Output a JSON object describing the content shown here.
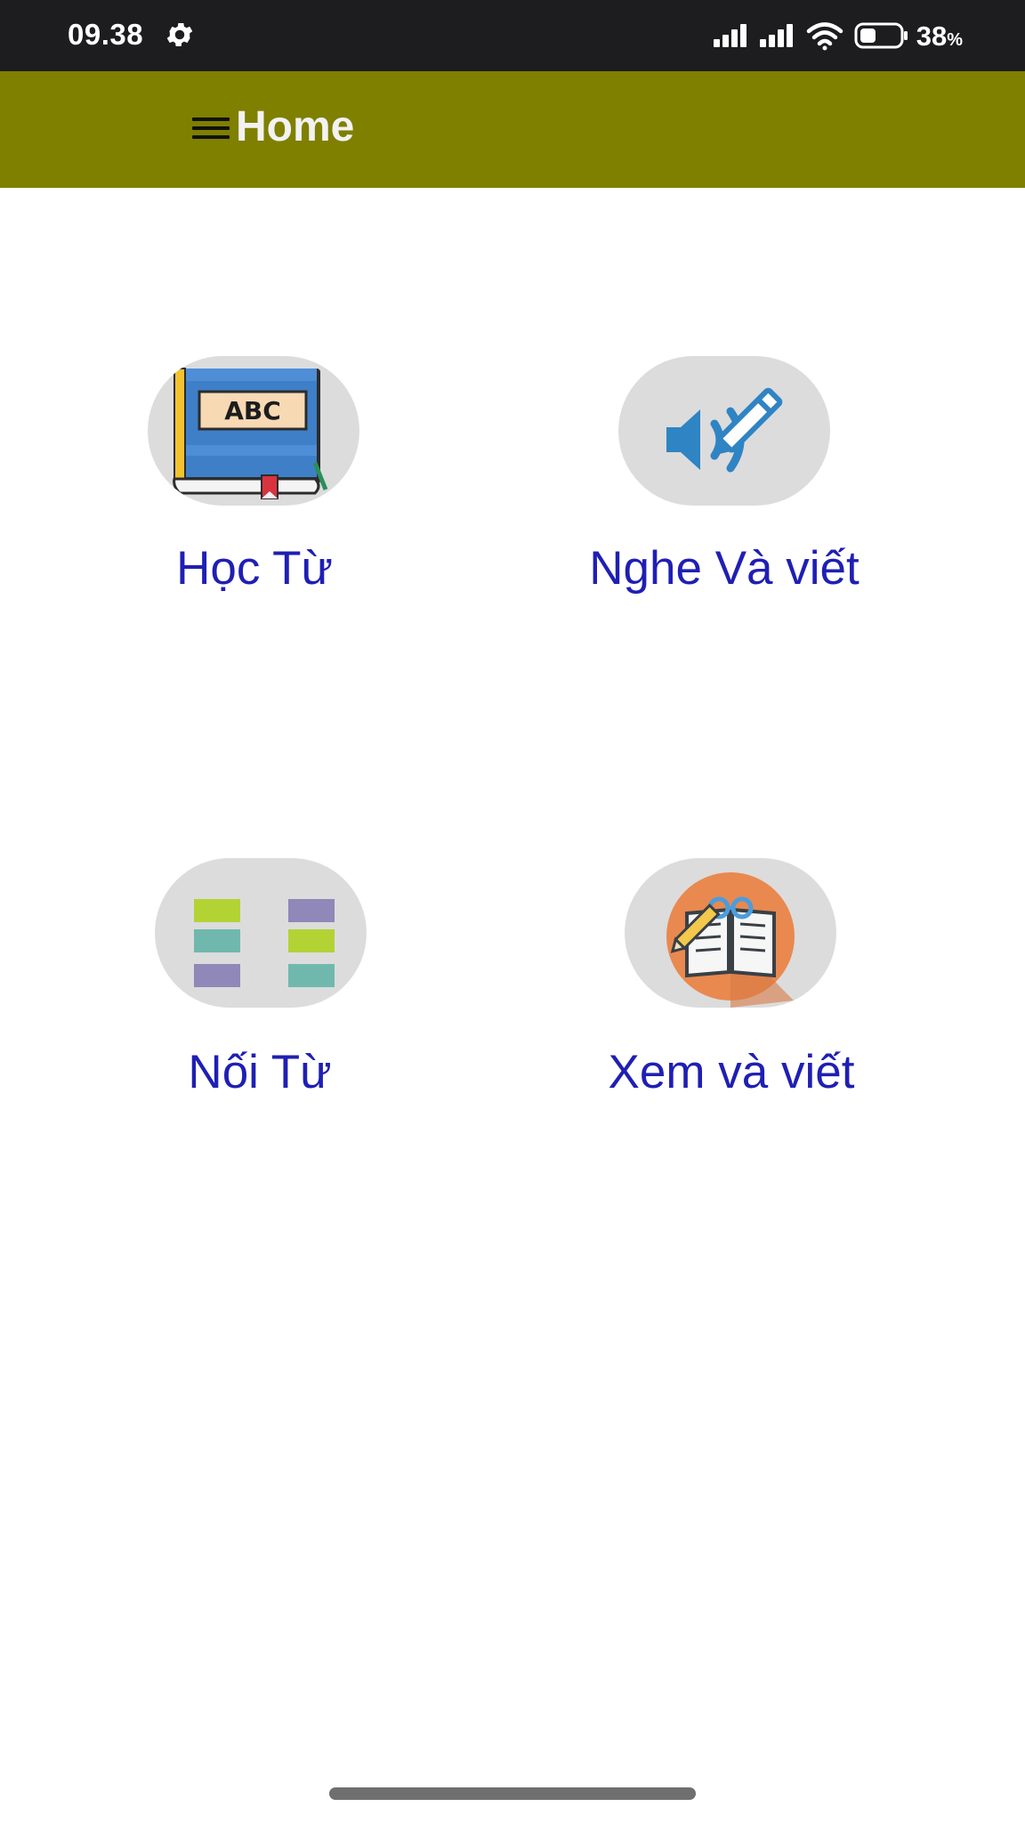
{
  "status_bar": {
    "time": "09.38",
    "battery_percent": "38",
    "battery_unit": "%",
    "icons": [
      "gear-icon",
      "signal-icon",
      "signal-icon",
      "wifi-icon",
      "battery-icon"
    ]
  },
  "app_bar": {
    "title": "Home",
    "menu_icon": "menu-icon",
    "background_color": "#7f7f00"
  },
  "tiles": [
    {
      "label": "Học Từ",
      "icon": "abc-book-icon"
    },
    {
      "label": "Nghe Và viết",
      "icon": "speaker-pencil-icon"
    },
    {
      "label": "Nối Từ",
      "icon": "match-blocks-icon"
    },
    {
      "label": "Xem và viết",
      "icon": "notebook-pencil-icon"
    }
  ],
  "colors": {
    "label_text": "#1f1fb4",
    "icon_background": "#dcdcdc",
    "status_bar": "#1d1d1f"
  }
}
